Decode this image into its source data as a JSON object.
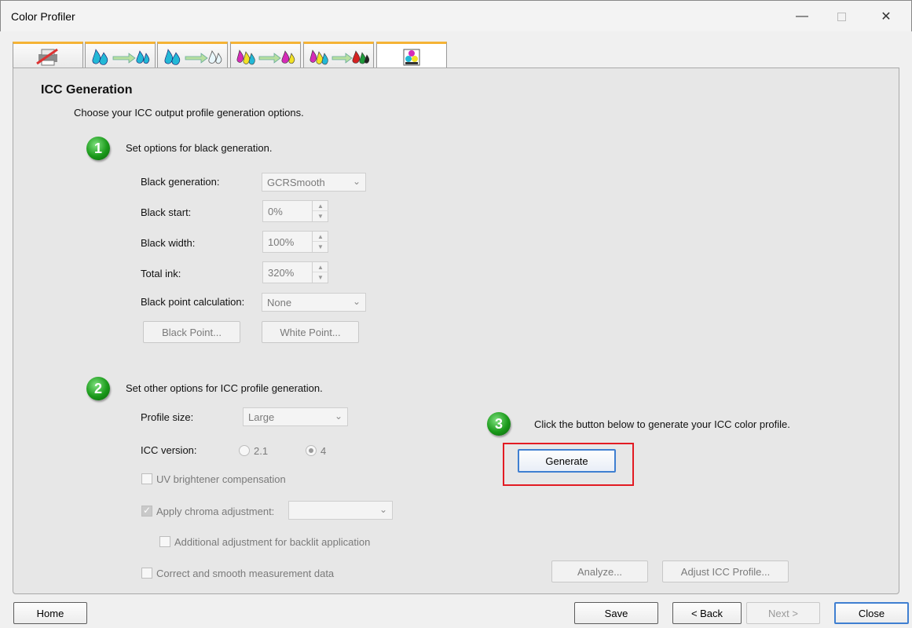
{
  "window": {
    "title": "Color Profiler"
  },
  "tabs": [
    {
      "icon": "printer-setup-icon",
      "active": false
    },
    {
      "icon": "ink-to-ink-icon",
      "active": false
    },
    {
      "icon": "ink-linearization-icon",
      "active": false
    },
    {
      "icon": "ink-limit-icon",
      "active": false
    },
    {
      "icon": "color-profile-icon",
      "active": false
    },
    {
      "icon": "icc-generation-icon",
      "active": true
    }
  ],
  "page": {
    "heading": "ICC Generation",
    "subtitle": "Choose your ICC output profile generation options."
  },
  "step1": {
    "number": "1",
    "label": "Set options for black generation.",
    "black_generation": {
      "label": "Black generation:",
      "value": "GCRSmooth"
    },
    "black_start": {
      "label": "Black start:",
      "value": "0%"
    },
    "black_width": {
      "label": "Black width:",
      "value": "100%"
    },
    "total_ink": {
      "label": "Total ink:",
      "value": "320%"
    },
    "black_point_calc": {
      "label": "Black point calculation:",
      "value": "None"
    },
    "black_point_button": "Black Point...",
    "white_point_button": "White Point..."
  },
  "step2": {
    "number": "2",
    "label": "Set other options for ICC profile generation.",
    "profile_size": {
      "label": "Profile size:",
      "value": "Large"
    },
    "icc_version": {
      "label": "ICC version:",
      "option1": "2.1",
      "option2": "4",
      "selected": "4"
    },
    "uv_brightener": "UV brightener compensation",
    "apply_chroma": "Apply chroma adjustment:",
    "chroma_value": "",
    "backlit": "Additional adjustment for backlit application",
    "correct_smooth": "Correct and smooth measurement data"
  },
  "step3": {
    "number": "3",
    "label": "Click the button below to generate your ICC color profile.",
    "generate_button": "Generate"
  },
  "panel_buttons": {
    "analyze": "Analyze...",
    "adjust_icc": "Adjust ICC Profile..."
  },
  "footer": {
    "home": "Home",
    "save": "Save",
    "back": "< Back",
    "next": "Next >",
    "close": "Close"
  },
  "colors": {
    "highlight": "#e21b23",
    "tab_accent": "#f5b335",
    "step_green": "#1a9a1a",
    "focus_blue": "#3f7fd1"
  }
}
